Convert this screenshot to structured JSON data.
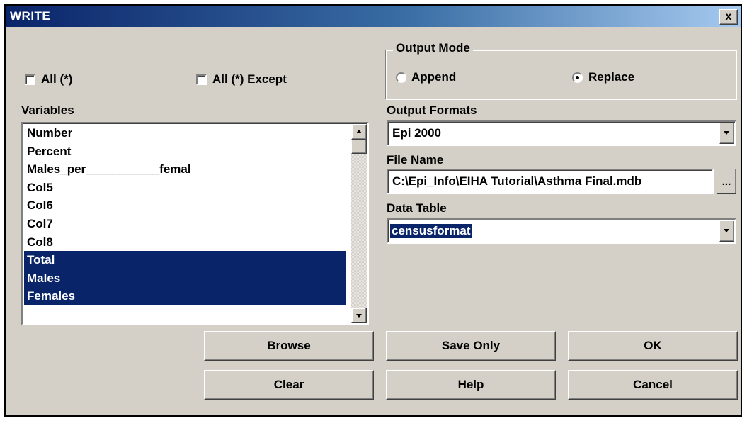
{
  "window": {
    "title": "WRITE",
    "close_label": "x"
  },
  "selection": {
    "all_label": "All (*)",
    "all_except_label": "All (*) Except"
  },
  "variables": {
    "label": "Variables",
    "items": [
      {
        "text": "Number",
        "selected": false
      },
      {
        "text": "Percent",
        "selected": false
      },
      {
        "text": "Males_per___________femal",
        "selected": false
      },
      {
        "text": "Col5",
        "selected": false
      },
      {
        "text": "Col6",
        "selected": false
      },
      {
        "text": "Col7",
        "selected": false
      },
      {
        "text": "Col8",
        "selected": false
      },
      {
        "text": "Total",
        "selected": true
      },
      {
        "text": "Males",
        "selected": true
      },
      {
        "text": "Females",
        "selected": true
      }
    ]
  },
  "output_mode": {
    "label": "Output Mode",
    "append_label": "Append",
    "replace_label": "Replace",
    "selected": "Replace"
  },
  "output_formats": {
    "label": "Output Formats",
    "value": "Epi 2000"
  },
  "file_name": {
    "label": "File Name",
    "value": "C:\\Epi_Info\\EIHA Tutorial\\Asthma Final.mdb",
    "browse_button": "..."
  },
  "data_table": {
    "label": "Data Table",
    "value": "censusformat"
  },
  "buttons": {
    "browse": "Browse",
    "save_only": "Save Only",
    "ok": "OK",
    "clear": "Clear",
    "help": "Help",
    "cancel": "Cancel"
  },
  "colors": {
    "title_gradient_start": "#0a246a",
    "title_gradient_end": "#a6caf0",
    "selection": "#0a246a",
    "face": "#d4d0c8"
  }
}
